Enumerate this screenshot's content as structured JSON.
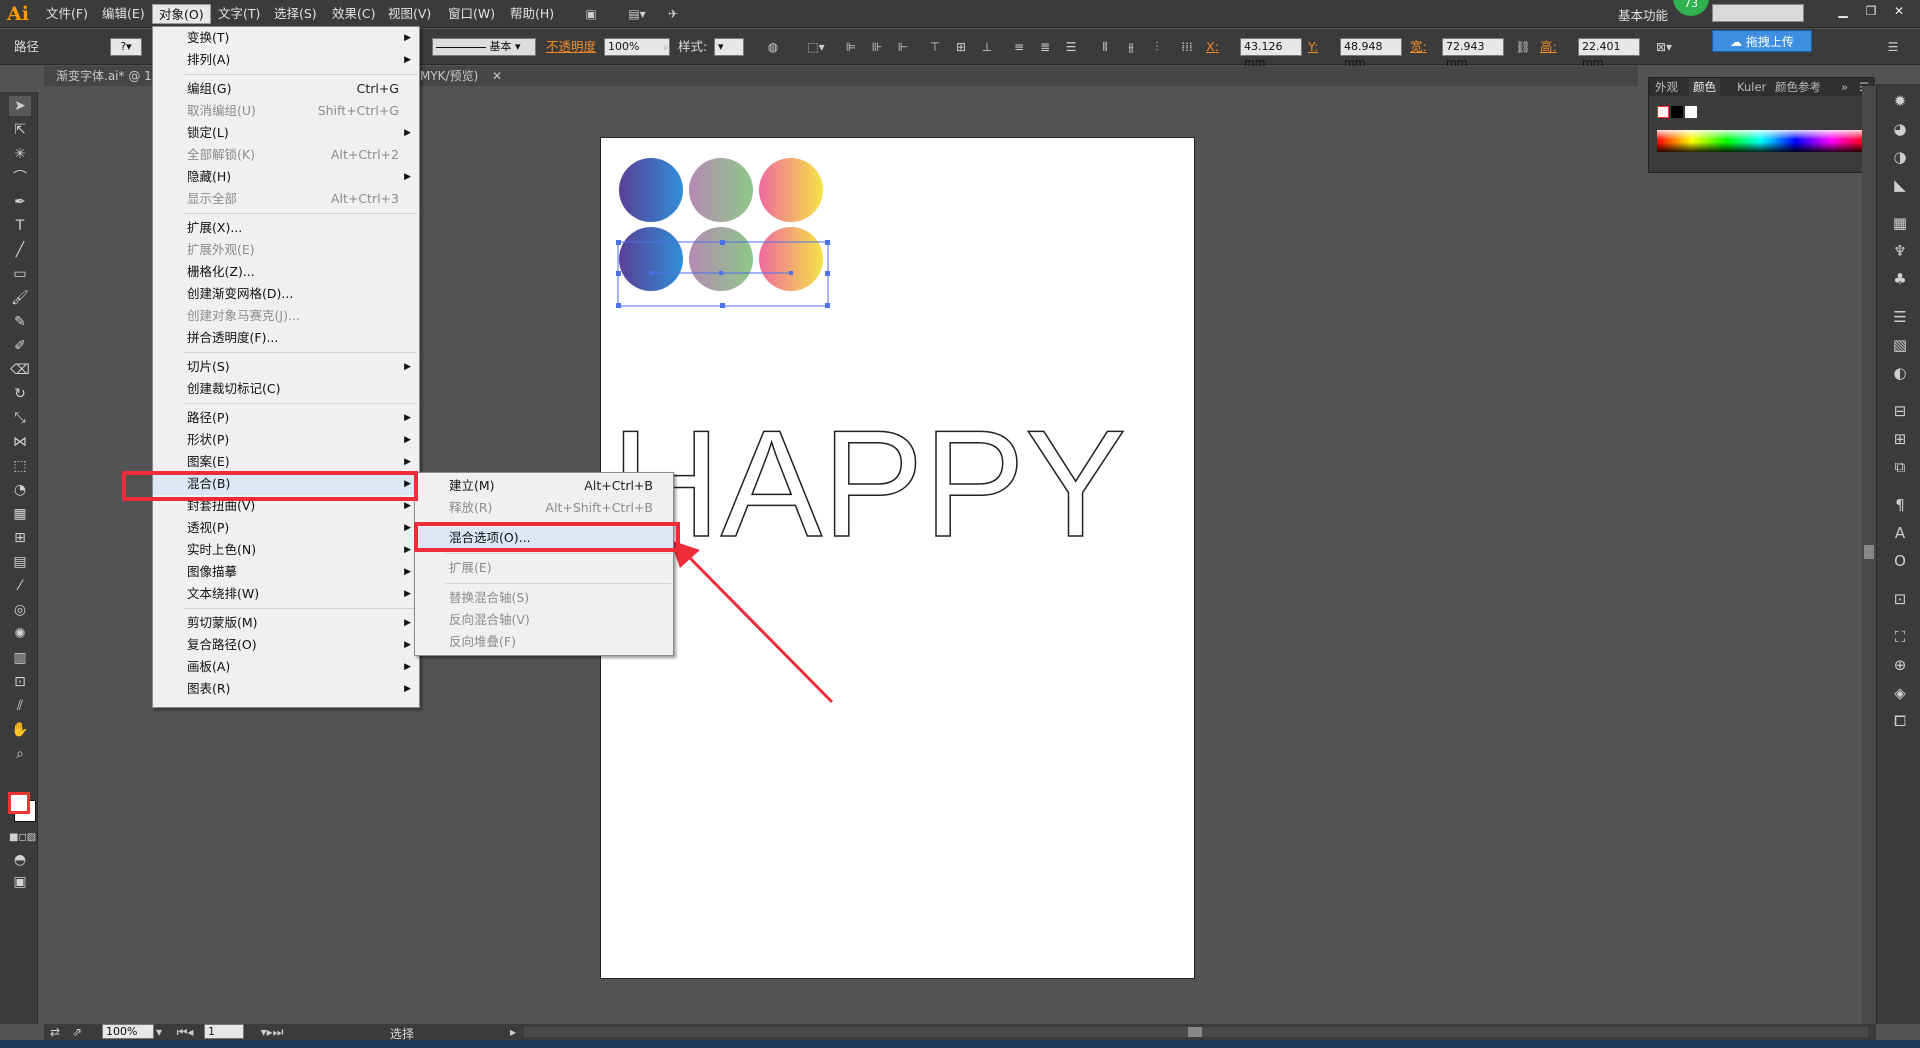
{
  "app": {
    "logo": "Ai",
    "workspace": "基本功能",
    "badge": "73",
    "upload_label": "拖拽上传"
  },
  "menubar": {
    "items": [
      "文件(F)",
      "编辑(E)",
      "对象(O)",
      "文字(T)",
      "选择(S)",
      "效果(C)",
      "视图(V)",
      "窗口(W)",
      "帮助(H)"
    ],
    "active": "对象(O)"
  },
  "optionsbar": {
    "path_label": "路径",
    "stroke_style": "基本",
    "opacity_label": "不透明度",
    "opacity_value": "100%",
    "style_label": "样式:",
    "x_label": "X:",
    "x_value": "43.126 mm",
    "y_label": "Y:",
    "y_value": "48.948 mm",
    "w_label": "宽:",
    "w_value": "72.943 mm",
    "h_label": "高:",
    "h_value": "22.401 mm"
  },
  "tabs": {
    "doc_tab": "渐变字体.ai* @ 10",
    "doc_tab_suffix": "MYK/预览)"
  },
  "panel": {
    "tabs": [
      "外观",
      "颜色",
      "Kuler",
      "颜色参考"
    ],
    "active": "颜色"
  },
  "object_menu": {
    "items": [
      {
        "label": "变换(T)",
        "submenu": true
      },
      {
        "label": "排列(A)",
        "submenu": true
      },
      {
        "label": "编组(G)",
        "shortcut": "Ctrl+G"
      },
      {
        "label": "取消编组(U)",
        "shortcut": "Shift+Ctrl+G",
        "disabled": true
      },
      {
        "label": "锁定(L)",
        "submenu": true
      },
      {
        "label": "全部解锁(K)",
        "shortcut": "Alt+Ctrl+2",
        "disabled": true
      },
      {
        "label": "隐藏(H)",
        "submenu": true
      },
      {
        "label": "显示全部",
        "shortcut": "Alt+Ctrl+3",
        "disabled": true
      },
      {
        "label": "扩展(X)..."
      },
      {
        "label": "扩展外观(E)",
        "disabled": true
      },
      {
        "label": "栅格化(Z)..."
      },
      {
        "label": "创建渐变网格(D)..."
      },
      {
        "label": "创建对象马赛克(J)...",
        "disabled": true
      },
      {
        "label": "拼合透明度(F)..."
      },
      {
        "label": "切片(S)",
        "submenu": true
      },
      {
        "label": "创建裁切标记(C)"
      },
      {
        "label": "路径(P)",
        "submenu": true
      },
      {
        "label": "形状(P)",
        "submenu": true
      },
      {
        "label": "图案(E)",
        "submenu": true
      },
      {
        "label": "混合(B)",
        "submenu": true
      },
      {
        "label": "封套扭曲(V)",
        "submenu": true
      },
      {
        "label": "透视(P)",
        "submenu": true
      },
      {
        "label": "实时上色(N)",
        "submenu": true
      },
      {
        "label": "图像描摹",
        "submenu": true
      },
      {
        "label": "文本绕排(W)",
        "submenu": true
      },
      {
        "label": "剪切蒙版(M)",
        "submenu": true
      },
      {
        "label": "复合路径(O)",
        "submenu": true
      },
      {
        "label": "画板(A)",
        "submenu": true
      },
      {
        "label": "图表(R)",
        "submenu": true
      }
    ]
  },
  "blend_menu": {
    "items": [
      {
        "label": "建立(M)",
        "shortcut": "Alt+Ctrl+B"
      },
      {
        "label": "释放(R)",
        "shortcut": "Alt+Shift+Ctrl+B",
        "disabled": true
      },
      {
        "label": "混合选项(O)..."
      },
      {
        "label": "扩展(E)",
        "disabled": true
      },
      {
        "label": "替换混合轴(S)",
        "disabled": true
      },
      {
        "label": "反向混合轴(V)",
        "disabled": true
      },
      {
        "label": "反向堆叠(F)",
        "disabled": true
      }
    ]
  },
  "canvas": {
    "outline_text": "HAPPY"
  },
  "statusbar": {
    "zoom": "100%",
    "page": "1",
    "tool": "选择"
  },
  "colors": {
    "highlight": "#ef2d3a",
    "accent": "#ff9a00"
  }
}
